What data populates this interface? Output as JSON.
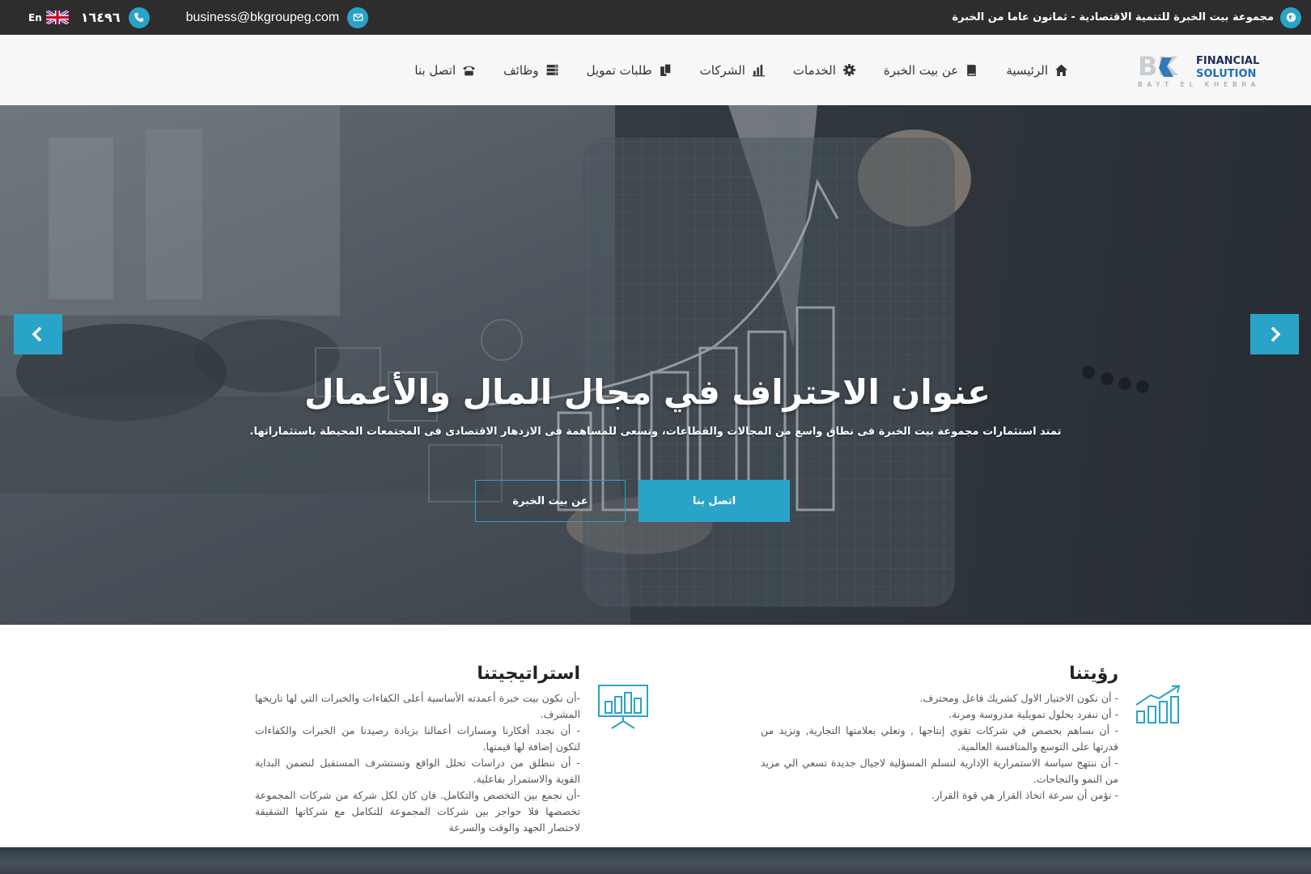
{
  "topbar": {
    "tagline": "مجموعة بيت الخبرة للتنمية الاقتصادية - ثمانون عاما من الخبرة",
    "email": "business@bkgroupeg.com",
    "phone": "١٦٤٩٦",
    "lang": "En",
    "icons": [
      "globe-icon",
      "email-icon",
      "phone-icon",
      "uk-flag-icon"
    ]
  },
  "logo": {
    "letters": "BK",
    "line1": "FINANCIAL",
    "line2": "SOLUTION",
    "line3": "BAYT EL KHEBRA"
  },
  "nav": {
    "items": [
      {
        "label": "الرئيسية",
        "icon": "home-icon"
      },
      {
        "label": "عن بيت الخبرة",
        "icon": "book-icon"
      },
      {
        "label": "الخدمات",
        "icon": "gear-icon"
      },
      {
        "label": "الشركات",
        "icon": "bar-chart-icon"
      },
      {
        "label": "طلبات تمويل",
        "icon": "files-icon"
      },
      {
        "label": "وظائف",
        "icon": "server-icon"
      },
      {
        "label": "اتصل بنا",
        "icon": "telephone-icon"
      }
    ]
  },
  "hero": {
    "title": "عنوان الاحتراف في مجال المال والأعمال",
    "subtitle": "تمتد استثمارات مجموعة بيت الخبرة فى نطاق واسع من المجالات والقطاعات، وتسعى للمساهمة فى الازدهار الاقتصادى فى المجتمعات المحيطة باستثماراتها.",
    "primary_button": "اتصل بنا",
    "secondary_button": "عن بيت الخبرة"
  },
  "vision": {
    "title": "رؤيتنا",
    "items": [
      "- أن نكون الاختيار الاول كشريك فاعل ومحترف.",
      "- أن ننفرد بحلول تمويلية مدروسة ومرنة.",
      "- أن نساهم بحصص في شركات تقوي إنتاجها , ونعلي بعلامتها التجارية, ونزيد من قدرتها على التوسع والمنافسة العالمية.",
      "- أن ننتهج سياسة الاستمرارية الإدارية لنسلم المسؤلية لاجيال جديدة تسعي الي مزيد من النمو والنجاحات.",
      "- نؤمن أن سرعة اتخاذ القرار هي قوة القرار."
    ]
  },
  "strategy": {
    "title": "استراتيجيتنا",
    "items": [
      "-أن نكون بيت خبرة أعمدته الأساسية أعلى الكفاءات والخبرات التي لها تاريخها المشرف.",
      "- أن نجدد أفكارنا ومسارات أعمالنا بزيادة رصيدنا من الخبرات والكفاءات لتكون إضافة لها قيمتها.",
      "- أن ننطلق من دراسات تحلل الواقع وتستشرف المستقبل لنضمن البداية القوية والاستمرار بفاعلية.",
      "-أن نجمع بين التخصص والتكامل. فان كان لكل شركة من شركات المجموعة تخصصها فلا حواجز بين شركات المجموعة للتكامل مع شركاتها الشقيقة لاختصار الجهد والوقت والسرعة"
    ]
  },
  "colors": {
    "accent": "#2aa3c9",
    "topbar_bg": "#2d2d2d",
    "header_bg": "#f7f7f7",
    "logo_blue": "#1f6fb5"
  }
}
